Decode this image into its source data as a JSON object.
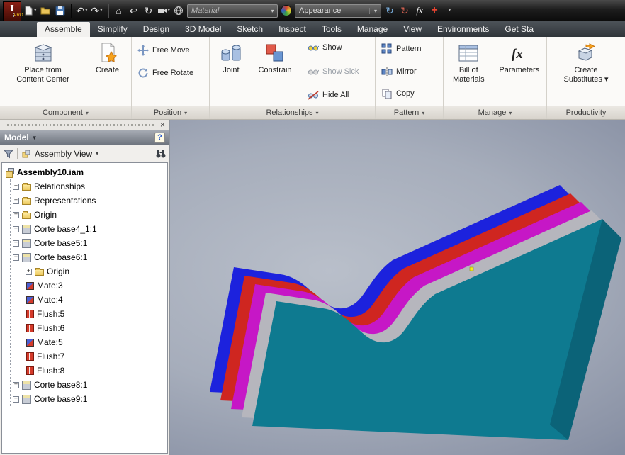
{
  "colors": {
    "stripe_blue": "#1c22dd",
    "stripe_red": "#cf2620",
    "stripe_magenta": "#c617c6",
    "stripe_silver": "#b6b6bd",
    "body_teal": "#0e7a90",
    "end_shade": "rgba(6,48,66,0.30)",
    "selection_yellow": "#f0f01e"
  },
  "glyphs": {
    "caret": "▾",
    "model_caret": "▼",
    "close": "×",
    "undo": "↶",
    "redo": "↷",
    "home": "⌂",
    "return": "↩",
    "update": "↻",
    "sync": "↻",
    "fx": "fx",
    "plus_red": "+",
    "help": "?",
    "plus": "+",
    "minus": "−"
  },
  "titlebar": {
    "logo": "I",
    "logo_sub": "PRO",
    "material": "Material",
    "appearance": "Appearance"
  },
  "tabs": [
    {
      "label": "Assemble"
    },
    {
      "label": "Simplify"
    },
    {
      "label": "Design"
    },
    {
      "label": "3D Model"
    },
    {
      "label": "Sketch"
    },
    {
      "label": "Inspect"
    },
    {
      "label": "Tools"
    },
    {
      "label": "Manage"
    },
    {
      "label": "View"
    },
    {
      "label": "Environments"
    },
    {
      "label": "Get Sta"
    }
  ],
  "ribbon": {
    "component": {
      "title": "Component",
      "place_line1": "Place from",
      "place_line2": "Content Center",
      "create": "Create"
    },
    "position": {
      "title": "Position",
      "free_move": "Free Move",
      "free_rotate": "Free Rotate"
    },
    "relationships": {
      "title": "Relationships",
      "joint": "Joint",
      "constrain": "Constrain",
      "show": "Show",
      "show_sick": "Show Sick",
      "hide_all": "Hide All"
    },
    "pattern": {
      "title": "Pattern",
      "pattern": "Pattern",
      "mirror": "Mirror",
      "copy": "Copy"
    },
    "manage": {
      "title": "Manage",
      "bom_line1": "Bill of",
      "bom_line2": "Materials",
      "parameters": "Parameters"
    },
    "productivity": {
      "title": "Productivity",
      "sub_line1": "Create",
      "sub_line2": "Substitutes"
    }
  },
  "browser": {
    "title": "Model",
    "view_mode": "Assembly View",
    "tree": [
      {
        "label": "Assembly10.iam"
      },
      {
        "label": "Relationships"
      },
      {
        "label": "Representations"
      },
      {
        "label": "Origin"
      },
      {
        "label": "Corte base4_1:1"
      },
      {
        "label": "Corte base5:1"
      },
      {
        "label": "Corte base6:1"
      },
      {
        "label": "Origin"
      },
      {
        "label": "Mate:3"
      },
      {
        "label": "Mate:4"
      },
      {
        "label": "Flush:5"
      },
      {
        "label": "Flush:6"
      },
      {
        "label": "Mate:5"
      },
      {
        "label": "Flush:7"
      },
      {
        "label": "Flush:8"
      },
      {
        "label": "Corte base8:1"
      },
      {
        "label": "Corte base9:1"
      }
    ]
  }
}
